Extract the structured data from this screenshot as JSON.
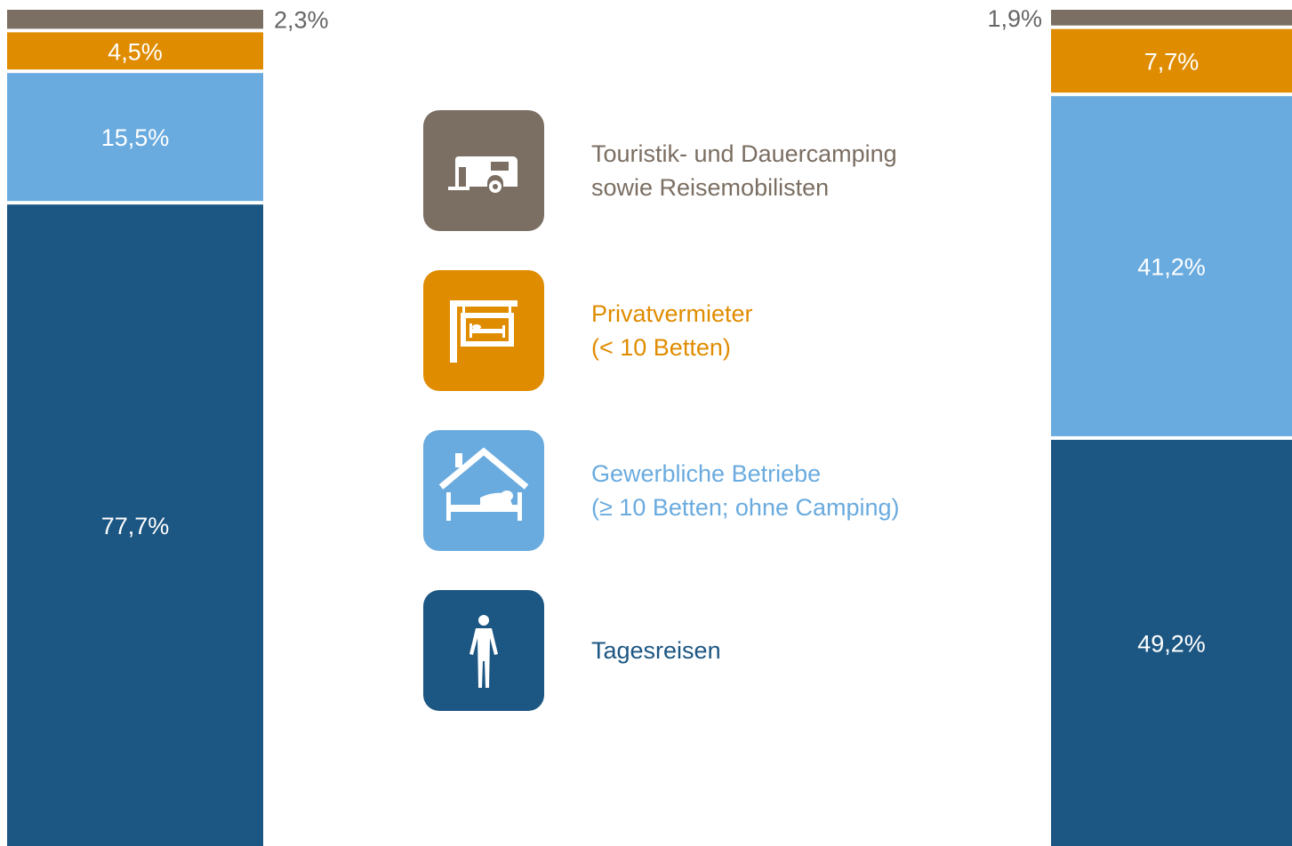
{
  "chart_data": [
    {
      "type": "bar",
      "stacked": true,
      "series": [
        {
          "name": "Tagesreisen",
          "value": 77.7,
          "label": "77,7%",
          "color": "#1c5682"
        },
        {
          "name": "Gewerbliche Betriebe",
          "value": 15.5,
          "label": "15,5%",
          "color": "#6aabdf"
        },
        {
          "name": "Privatvermieter",
          "value": 4.5,
          "label": "4,5%",
          "color": "#e08c00"
        },
        {
          "name": "Touristik- und Dauercamping",
          "value": 2.3,
          "label": "2,3%",
          "color": "#7b6e62"
        }
      ]
    },
    {
      "type": "bar",
      "stacked": true,
      "series": [
        {
          "name": "Tagesreisen",
          "value": 49.2,
          "label": "49,2%",
          "color": "#1c5682"
        },
        {
          "name": "Gewerbliche Betriebe",
          "value": 41.2,
          "label": "41,2%",
          "color": "#6aabdf"
        },
        {
          "name": "Privatvermieter",
          "value": 7.7,
          "label": "7,7%",
          "color": "#e08c00"
        },
        {
          "name": "Touristik- und Dauercamping",
          "value": 1.9,
          "label": "1,9%",
          "color": "#7b6e62"
        }
      ]
    }
  ],
  "legend": [
    {
      "icon": "caravan-icon",
      "color": "#7b6e62",
      "line1": "Touristik- und Dauercamping",
      "line2": "sowie Reisemobilisten"
    },
    {
      "icon": "hanging-sign-bed-icon",
      "color": "#e08c00",
      "line1": "Privatvermieter",
      "line2": "(< 10 Betten)"
    },
    {
      "icon": "house-bed-icon",
      "color": "#6aabdf",
      "line1": "Gewerbliche Betriebe",
      "line2": "(≥ 10 Betten; ohne Camping)"
    },
    {
      "icon": "person-icon",
      "color": "#1c5682",
      "line1": "Tagesreisen",
      "line2": ""
    }
  ]
}
